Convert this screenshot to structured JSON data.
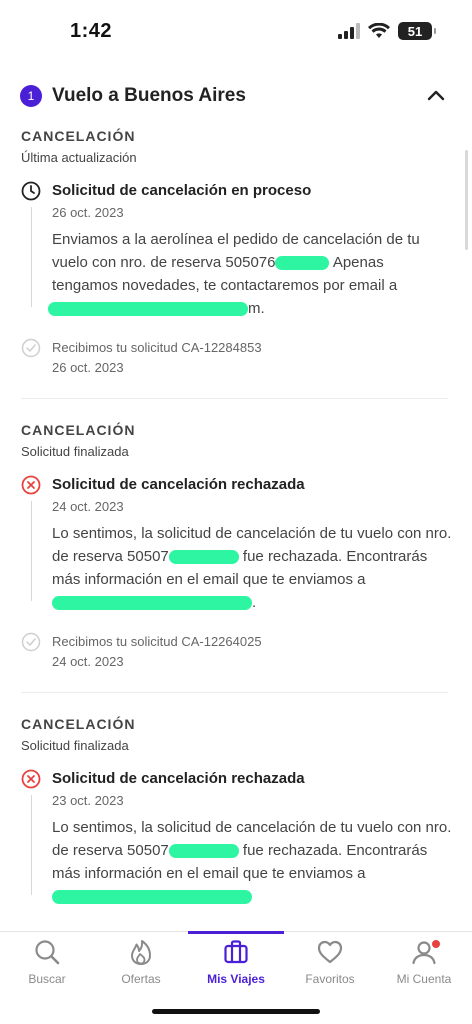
{
  "status": {
    "time": "1:42",
    "battery": "51"
  },
  "header": {
    "step": "1",
    "title": "Vuelo a Buenos Aires"
  },
  "sections": [
    {
      "label": "CANCELACIÓN",
      "subtitle": "Última actualización",
      "event": {
        "title": "Solicitud de cancelación en proceso",
        "date": "26 oct. 2023",
        "body_1": "Enviamos a la aerolínea el pedido de cancelación de tu vuelo con nro. de reserva 505076",
        "body_2": " Apenas tengamos novedades, te contactaremos por email a",
        "body_3": "m."
      },
      "received": {
        "text": "Recibimos tu solicitud CA-12284853",
        "date": "26 oct. 2023"
      }
    },
    {
      "label": "CANCELACIÓN",
      "subtitle": "Solicitud finalizada",
      "event": {
        "title": "Solicitud de cancelación rechazada",
        "date": "24 oct. 2023",
        "body_1": "Lo sentimos, la solicitud de cancelación de tu vuelo con nro. de reserva 50507",
        "body_2": "fue rechazada. Encontrarás más información en el email que te enviamos a",
        "body_3": "."
      },
      "received": {
        "text": "Recibimos tu solicitud CA-12264025",
        "date": "24 oct. 2023"
      }
    },
    {
      "label": "CANCELACIÓN",
      "subtitle": "Solicitud finalizada",
      "event": {
        "title": "Solicitud de cancelación rechazada",
        "date": "23 oct. 2023",
        "body_1": "Lo sentimos, la solicitud de cancelación de tu vuelo con nro. de reserva 50507",
        "body_2": "fue rechazada. Encontrarás más información en el email que te enviamos a",
        "body_3": ""
      }
    }
  ],
  "tabbar": {
    "tabs": [
      {
        "label": "Buscar",
        "icon": "search-icon"
      },
      {
        "label": "Ofertas",
        "icon": "flame-icon"
      },
      {
        "label": "Mis Viajes",
        "icon": "suitcase-icon",
        "active": true
      },
      {
        "label": "Favoritos",
        "icon": "heart-icon"
      },
      {
        "label": "Mi Cuenta",
        "icon": "user-icon"
      }
    ]
  },
  "colors": {
    "accent": "#4b1fd6",
    "error": "#e8423f",
    "redaction": "#2df5a2"
  }
}
